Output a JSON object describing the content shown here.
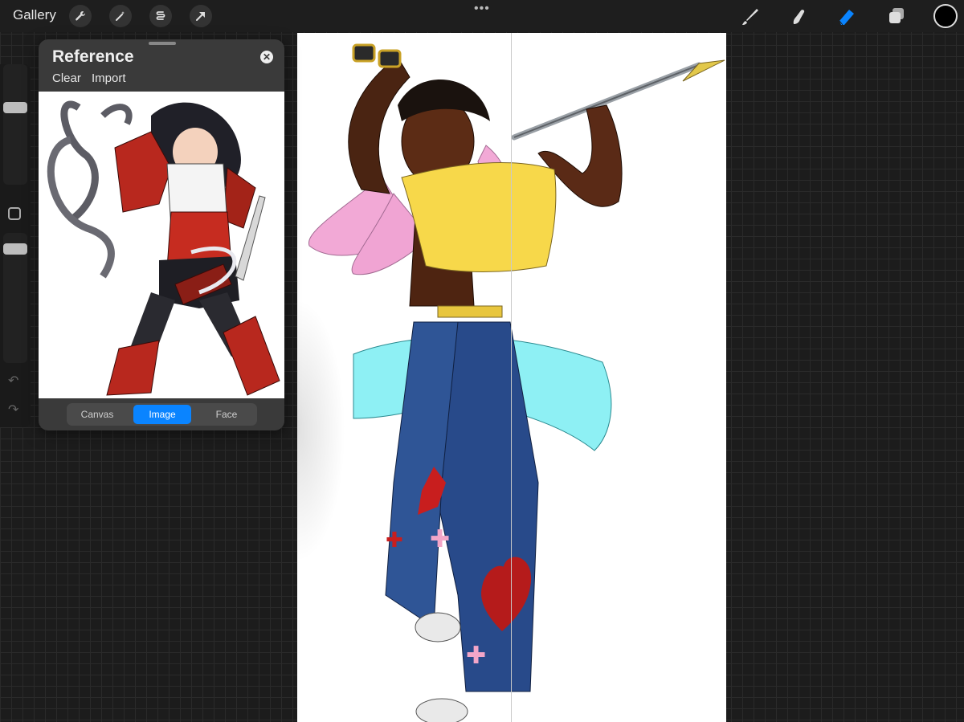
{
  "topbar": {
    "gallery_label": "Gallery",
    "tools_left": [
      "wrench-icon",
      "magic-wand-icon",
      "selection-icon",
      "transform-arrow-icon"
    ],
    "more_label": "•••",
    "tools_right": [
      "brush-icon",
      "smudge-icon",
      "eraser-icon",
      "layers-icon"
    ],
    "active_tool": "eraser",
    "active_color": "#000000",
    "accent": "#0a84ff"
  },
  "sidebar": {
    "brush_size_level": 0.35,
    "opacity_level": 0.05
  },
  "reference": {
    "title": "Reference",
    "clear_label": "Clear",
    "import_label": "Import",
    "tabs": [
      {
        "label": "Canvas",
        "active": false
      },
      {
        "label": "Image",
        "active": true
      },
      {
        "label": "Face",
        "active": false
      }
    ]
  }
}
